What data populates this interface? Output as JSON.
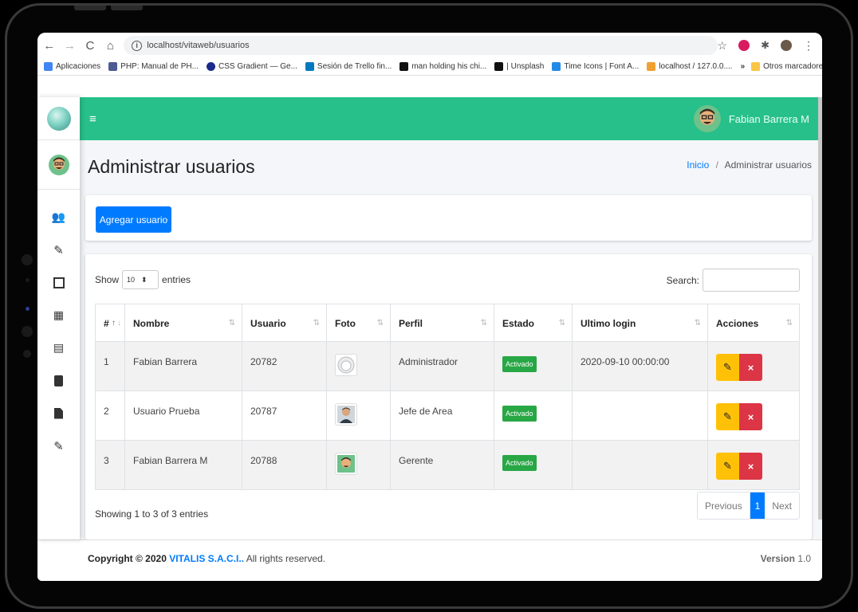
{
  "browser": {
    "url": "localhost/vitaweb/usuarios",
    "bookmarks": [
      "Aplicaciones",
      "PHP: Manual de PH...",
      "CSS Gradient — Ge...",
      "Sesión de Trello fin...",
      "man holding his chi...",
      "| Unsplash",
      "Time Icons | Font A...",
      "localhost / 127.0.0...."
    ],
    "more": "»",
    "other_bookmarks": "Otros marcadores"
  },
  "topbar": {
    "menu_icon": "≡",
    "user_name": "Fabian Barrera M"
  },
  "page": {
    "title": "Administrar usuarios",
    "breadcrumb_home": "Inicio",
    "breadcrumb_sep": "/",
    "breadcrumb_current": "Administrar usuarios",
    "add_button": "Agregar usuario"
  },
  "table": {
    "show_label": "Show",
    "entries_value": "10",
    "entries_label": "entries",
    "search_label": "Search:",
    "headers": [
      "#",
      "Nombre",
      "Usuario",
      "Foto",
      "Perfil",
      "Estado",
      "Ultimo login",
      "Acciones"
    ],
    "rows": [
      {
        "num": "1",
        "nombre": "Fabian Barrera",
        "usuario": "20782",
        "perfil": "Administrador",
        "estado": "Activado",
        "login": "2020-09-10 00:00:00"
      },
      {
        "num": "2",
        "nombre": "Usuario Prueba",
        "usuario": "20787",
        "perfil": "Jefe de Area",
        "estado": "Activado",
        "login": ""
      },
      {
        "num": "3",
        "nombre": "Fabian Barrera M",
        "usuario": "20788",
        "perfil": "Gerente",
        "estado": "Activado",
        "login": ""
      }
    ],
    "info": "Showing 1 to 3 of 3 entries",
    "prev": "Previous",
    "page": "1",
    "next": "Next"
  },
  "footer": {
    "copyright_prefix": "Copyright © 2020",
    "company": "VITALIS S.A.C.I..",
    "rights": "All rights reserved.",
    "version_label": "Version",
    "version_value": "1.0"
  },
  "colors": {
    "accent": "#28c08a",
    "primary": "#007bff",
    "success": "#28a745",
    "warning": "#ffc107",
    "danger": "#dc3545"
  }
}
